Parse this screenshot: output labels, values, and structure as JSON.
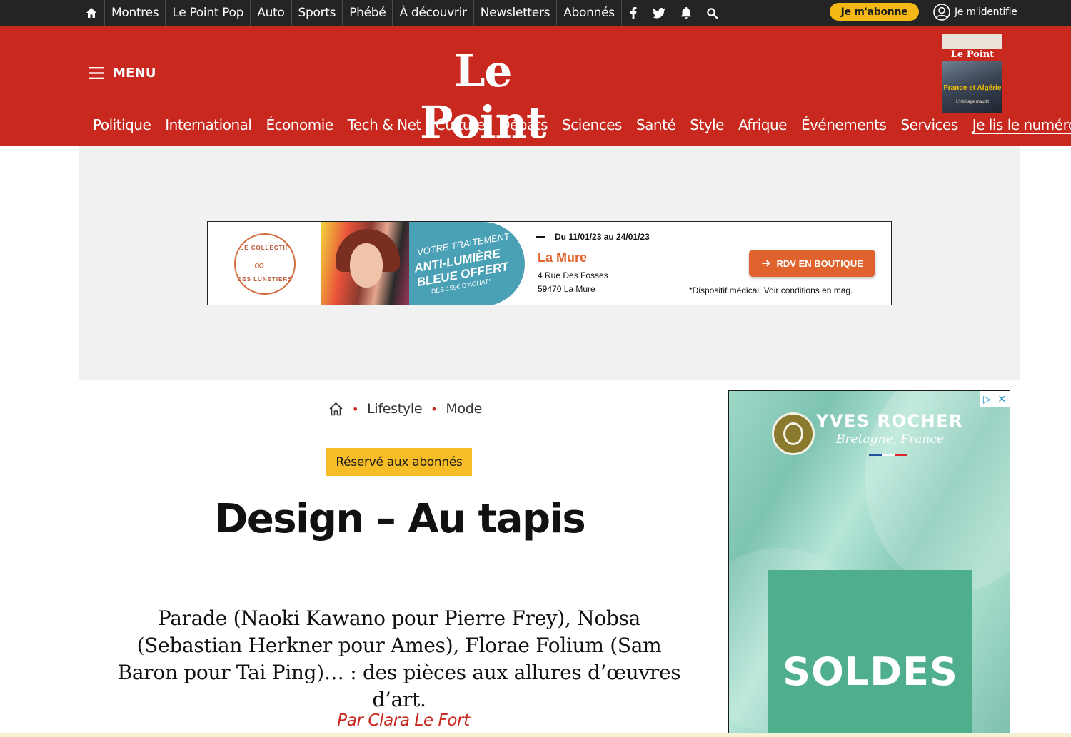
{
  "topbar": {
    "links": [
      "Montres",
      "Le Point Pop",
      "Auto",
      "Sports",
      "Phébé",
      "À découvrir",
      "Newsletters",
      "Abonnés"
    ],
    "icons": [
      "home-icon",
      "facebook-icon",
      "twitter-icon",
      "bell-icon",
      "search-icon"
    ],
    "subscribe_label": "Je m'abonne",
    "login_label": "Je m'identifie"
  },
  "header": {
    "menu_label": "MENU",
    "logo": "Le Point",
    "nav": [
      "Politique",
      "International",
      "Économie",
      "Tech & Net",
      "Culture",
      "Débats",
      "Sciences",
      "Santé",
      "Style",
      "Afrique",
      "Événements",
      "Services"
    ],
    "issue_link": "Je lis le numéro",
    "cover": {
      "masthead": "Le Point",
      "title": "France et Algérie",
      "subtitle": "L'héritage maudit"
    }
  },
  "ad_banner": {
    "brand_top": "LE COLLECTIF",
    "brand_bottom": "DES LUNETIERS",
    "promo_line1": "VOTRE TRAITEMENT",
    "promo_line2": "ANTI-LUMIÈRE BLEUE OFFERT",
    "promo_line3": "DÈS 159€ D'ACHAT*",
    "dates": "Du 11/01/23 au 24/01/23",
    "city": "La Mure",
    "address1": "4 Rue Des Fosses",
    "address2": "59470 La Mure",
    "cta": "RDV EN BOUTIQUE",
    "note": "*Dispositif médical. Voir conditions en mag.",
    "accent_color": "#e0632d"
  },
  "article": {
    "breadcrumb": [
      "Lifestyle",
      "Mode"
    ],
    "badge": "Réservé aux abonnés",
    "title": "Design – Au tapis",
    "lead": "Parade (Naoki Kawano pour Pierre Frey), Nobsa (Sebastian Herkner pour Ames), Florae Folium (Sam Baron pour Tai Ping)… : des pièces aux allures d’œuvres d’art.",
    "author": "Par Clara Le Fort"
  },
  "side_ad": {
    "brand": "YVES ROCHER",
    "tagline": "Bretagne, France",
    "headline": "SOLDES"
  },
  "colors": {
    "brand_red": "#c8281e",
    "subscribe_yellow": "#f5b915",
    "badge_yellow": "#f6bd27"
  }
}
